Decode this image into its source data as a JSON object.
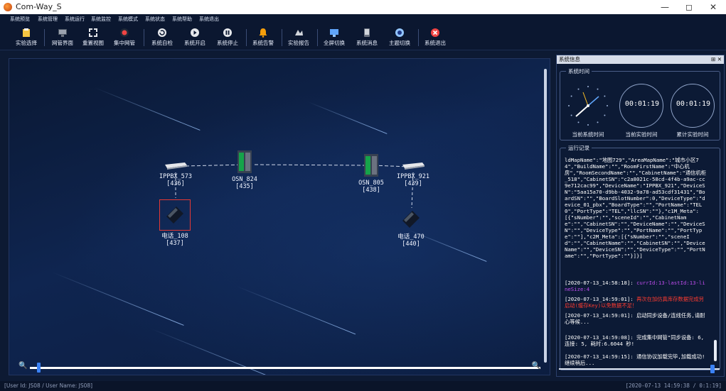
{
  "window": {
    "title": "Com-Way_S",
    "controls": [
      "—",
      "◻",
      "✕"
    ]
  },
  "menu": [
    "系统预览",
    "系统管理",
    "系统运行",
    "系统监控",
    "系统模式",
    "系统状态",
    "系统帮助",
    "系统退出"
  ],
  "toolbar": [
    {
      "label": "实验选择",
      "icon": "clipboard-icon"
    },
    {
      "label": "网管界面",
      "icon": "monitor-icon"
    },
    {
      "label": "重置视图",
      "icon": "expand-icon"
    },
    {
      "label": "集中网管",
      "icon": "hub-icon"
    },
    {
      "label": "系统自检",
      "icon": "refresh-icon"
    },
    {
      "label": "系统开启",
      "icon": "play-icon"
    },
    {
      "label": "系统停止",
      "icon": "pause-icon"
    },
    {
      "label": "系统告警",
      "icon": "bell-icon"
    },
    {
      "label": "实验报告",
      "icon": "report-icon"
    },
    {
      "label": "全屏切换",
      "icon": "fullscreen-icon"
    },
    {
      "label": "系统消息",
      "icon": "message-icon"
    },
    {
      "label": "主题切换",
      "icon": "theme-icon"
    },
    {
      "label": "系统退出",
      "icon": "exit-icon"
    }
  ],
  "topology": {
    "devices": [
      {
        "name": "IPPBX_573",
        "id": "[436]",
        "type": "ippbx"
      },
      {
        "name": "OSN_824",
        "id": "[435]",
        "type": "osn"
      },
      {
        "name": "OSN_805",
        "id": "[438]",
        "type": "osn"
      },
      {
        "name": "IPPBX_921",
        "id": "[439]",
        "type": "ippbx"
      },
      {
        "name": "电话_108",
        "id": "[437]",
        "type": "phone",
        "selected": true
      },
      {
        "name": "电话_470",
        "id": "[440]",
        "type": "phone"
      }
    ]
  },
  "panel": {
    "title": "系统信息",
    "controls": "⊞ ✕",
    "time_group": "系统时间",
    "clocks": [
      {
        "caption": "当前系统时间",
        "time": ""
      },
      {
        "caption": "当前实验时间",
        "time": "00:01:19"
      },
      {
        "caption": "累计实验时间",
        "time": "00:01:19"
      }
    ],
    "log_group": "运行记录",
    "log_json": "ldMapName\":\"地图729\",\"AreaMapName\":\"城市小区74\",\"BuildName\":\"\",\"RoomFirstName\":\"中心机房\",\"RoomSecondName\":\"\",\"CabinetName\":\"通信机柜_518\",\"CabinetSN\":\"c2a8021c-58cd-4f4b-a9ac-cc9e712cac99\",\"DeviceName\":\"IPPBX_921\",\"DeviceSN\":\"5aa15a70-d9bb-4032-9a78-ad53cdf31431\",\"BoardSN\":\"\",\"BoardSlotNumber\":0,\"DeviceType\":\"device_01_pbx\",\"BoardType\":\"\",\"PortName\":\"TEL0\",\"PortType\":\"TEL\",\"llcSN\":\"\"},\"c1M_Meta\":[{\"sNumber\":\"\",\"sceneId\":\"\",\"CabinetName\":\"\",\"CabinetSN\":\"\",\"DeviceName\":\"\",\"DeviceSN\":\"\",\"DeviceType\":\"\",\"PortName\":\"\",\"PortType\":\"\"],\"c2M_Meta\":[{\"sNumber\":\"\",\"sceneId\":\"\",\"CabinetName\":\"\",\"CabinetSN\":\"\",\"DeviceName\":\"\",\"DeviceSN\":\"\",\"DeviceType\":\"\",\"PortName\":\"\",\"PortType\":\"\"}]}]",
    "log_entries": [
      {
        "ts": "[2020-07-13_14:58:18]:",
        "text": "currId:13-lastId:13-lineSize:4",
        "color": "#c04cf0"
      },
      {
        "ts": "[2020-07-13_14:59:01]:",
        "text": "再次在加仿真库存数据完成另启动(缓存Key)以免数据不足！",
        "color": "#ff3b30"
      },
      {
        "ts": "[2020-07-13_14:59:01]:",
        "text": "启动同步设备/连线任务,请耐心等候...",
        "color": "#ffffff"
      },
      {
        "ts": "[2020-07-13_14:59:08]:",
        "text": "完成集中网管\"同步设备: 6, 连接: 5, 耗时:6.6044 秒!",
        "color": "#ffffff"
      },
      {
        "ts": "[2020-07-13_14:59:15]:",
        "text": "通信协议加载完毕,加载成功!继续稍后...",
        "color": "#ffffff"
      }
    ]
  },
  "status": {
    "user": "[User Id: JS08 / User Name: JS08]",
    "time": "[2020-07-13 14:59:38 / 0:1:19]"
  },
  "colors": {
    "accent": "#3b82f6",
    "selection": "#e53935",
    "link_line": "#cfd8ea"
  }
}
